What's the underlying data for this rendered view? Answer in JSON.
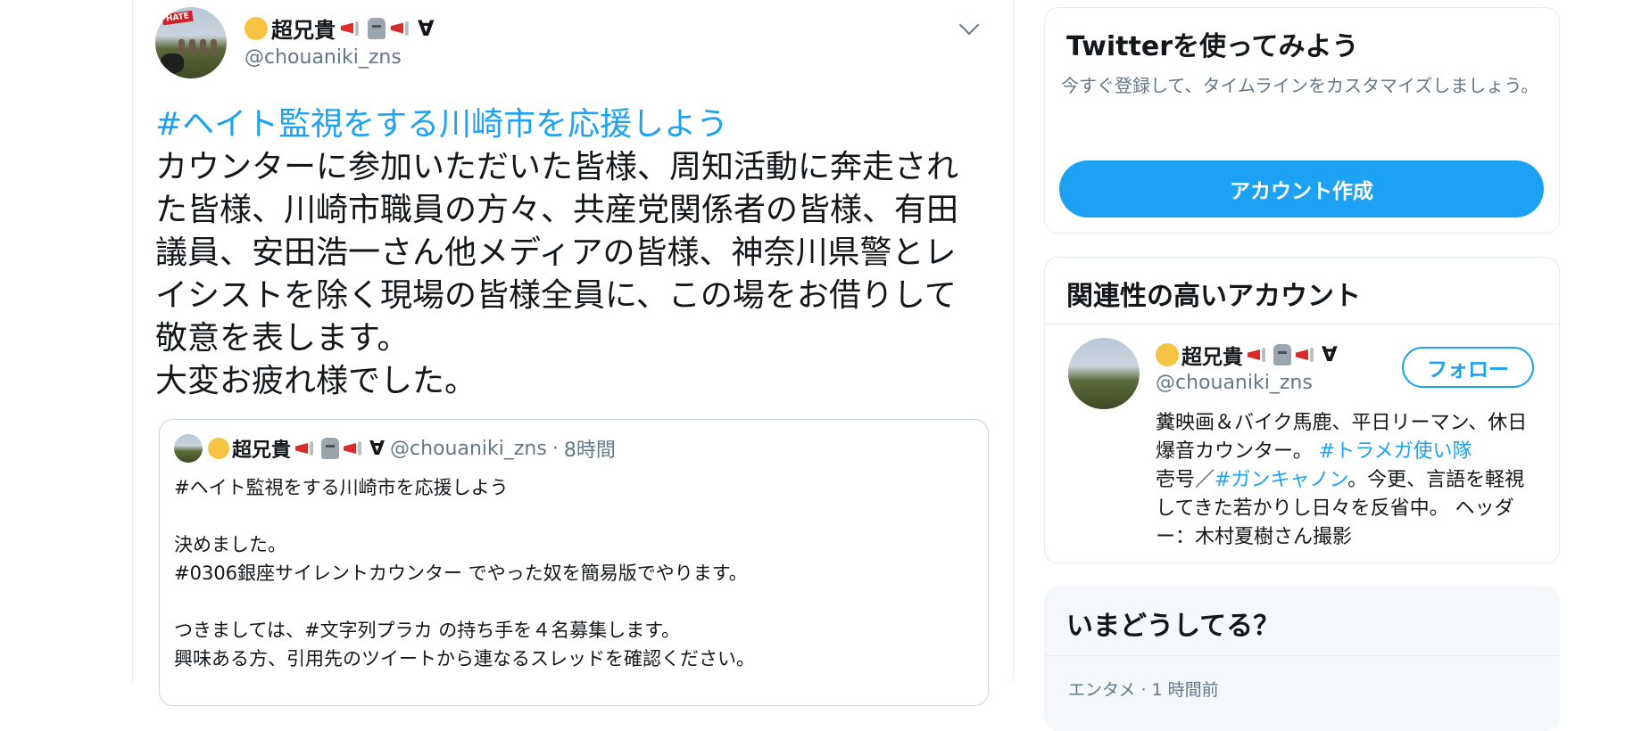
{
  "tweet": {
    "author_name": "超兄貴",
    "author_suffix": "∀",
    "handle": "@chouaniki_zns",
    "hashtag": "#ヘイト監視をする川崎市を応援しよう",
    "body": "カウンターに参加いただいた皆様、周知活動に奔走された皆様、川崎市職員の方々、共産党関係者の皆様、有田議員、安田浩一さん他メディアの皆様、神奈川県警とレイシストを除く現場の皆様全員に、この場をお借りして敬意を表します。\n大変お疲れ様でした。"
  },
  "quote": {
    "author_name": "超兄貴",
    "author_suffix": "∀",
    "handle": "@chouaniki_zns",
    "separator": "·",
    "time": "8時間",
    "text": "#ヘイト監視をする川崎市を応援しよう\n\n決めました。\n#0306銀座サイレントカウンター でやった奴を簡易版でやります。\n\nつきましては、#文字列プラカ の持ち手を４名募集します。\n興味ある方、引用先のツイートから連なるスレッドを確認ください。"
  },
  "signup_card": {
    "title": "Twitterを使ってみよう",
    "description": "今すぐ登録して、タイムラインをカスタマイズしましょう。",
    "button_label": "アカウント作成"
  },
  "related_card": {
    "title": "関連性の高いアカウント",
    "account": {
      "name": "超兄貴",
      "suffix": "∀",
      "handle": "@chouaniki_zns",
      "follow_label": "フォロー",
      "bio_part1": "糞映画＆バイク馬鹿、平日リーマン、休日爆音カウンター。 ",
      "bio_tag1": "#トラメガ使い隊",
      "bio_part2": "壱号／",
      "bio_tag2": "#ガンキャノン",
      "bio_part3": "。今更、言語を軽視してきた若かりし日々を反省中。 ヘッダー：木村夏樹さん撮影"
    }
  },
  "trends_card": {
    "title": "いまどうしてる？",
    "first_item_meta": "エンタメ · 1 時間前"
  },
  "colors": {
    "accent": "#1da1f2",
    "muted_text": "#657786",
    "border": "#e6ecf0"
  }
}
